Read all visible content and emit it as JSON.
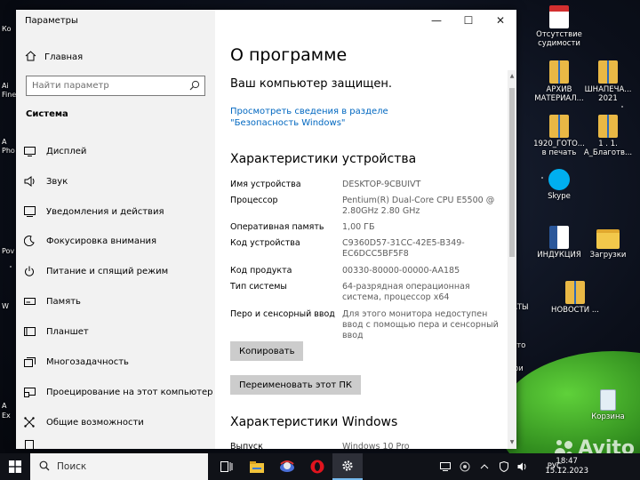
{
  "window": {
    "title": "Параметры",
    "controls": {
      "minimize": "—",
      "maximize": "☐",
      "close": "✕"
    }
  },
  "sidebar": {
    "home": "Главная",
    "search_placeholder": "Найти параметр",
    "section": "Система",
    "items": [
      {
        "label": "Дисплей",
        "icon": "display-icon"
      },
      {
        "label": "Звук",
        "icon": "sound-icon"
      },
      {
        "label": "Уведомления и действия",
        "icon": "notifications-icon"
      },
      {
        "label": "Фокусировка внимания",
        "icon": "focus-moon-icon"
      },
      {
        "label": "Питание и спящий режим",
        "icon": "power-icon"
      },
      {
        "label": "Память",
        "icon": "storage-icon"
      },
      {
        "label": "Планшет",
        "icon": "tablet-icon"
      },
      {
        "label": "Многозадачность",
        "icon": "multitasking-icon"
      },
      {
        "label": "Проецирование на этот компьютер",
        "icon": "projecting-icon"
      },
      {
        "label": "Общие возможности",
        "icon": "shared-experiences-icon"
      }
    ]
  },
  "content": {
    "title": "О программе",
    "protected": "Ваш компьютер защищен.",
    "security_link": "Просмотреть сведения в разделе \"Безопасность Windows\"",
    "device_heading": "Характеристики устройства",
    "specs": [
      {
        "key": "Имя устройства",
        "value": "DESKTOP-9CBUIVT"
      },
      {
        "key": "Процессор",
        "value": "Pentium(R) Dual-Core  CPU      E5500  @ 2.80GHz   2.80 GHz"
      },
      {
        "key": "Оперативная память",
        "value": "1,00 ГБ"
      },
      {
        "key": "Код устройства",
        "value": "C9360D57-31CC-42E5-B349-EC6DCC5BF5F8"
      },
      {
        "key": "Код продукта",
        "value": "00330-80000-00000-AA185"
      },
      {
        "key": "Тип системы",
        "value": "64-разрядная операционная система, процессор x64"
      },
      {
        "key": "Перо и сенсорный ввод",
        "value": "Для этого монитора недоступен ввод с помощью пера и сенсорный ввод"
      }
    ],
    "copy_button": "Копировать",
    "rename_button": "Переименовать этот ПК",
    "windows_heading": "Характеристики Windows",
    "partial_row": {
      "key": "Выпуск",
      "value": "Windows 10 Pro"
    }
  },
  "desktop_icons": [
    {
      "label": "Отсутствие судимости",
      "icon": "pdf-file-icon"
    },
    {
      "label": "АРХИВ МАТЕРИАЛ...",
      "icon": "archive-icon"
    },
    {
      "label": "ШНАПЕЧА... 2021",
      "icon": "archive-icon"
    },
    {
      "label": "1920_ГОТО... в печать",
      "icon": "archive-icon"
    },
    {
      "label": "1 . 1. А_Благотв...",
      "icon": "archive-icon"
    },
    {
      "label": "Skype",
      "icon": "skype-icon"
    },
    {
      "label": "ИНДУКЦИЯ",
      "icon": "word-document-icon"
    },
    {
      "label": "Загрузки",
      "icon": "downloads-folder-icon"
    },
    {
      "label": "НОВОСТИ ...",
      "icon": "archive-icon"
    },
    {
      "label": "Корзина",
      "icon": "recycle-bin-icon"
    }
  ],
  "left_edge_labels": [
    "Ко",
    "Ai",
    "Fine",
    "A",
    "Pho",
    "Pov",
    "W",
    "А",
    "Ex"
  ],
  "right_edge_labels": [
    "АТЫ",
    "ато",
    "фи"
  ],
  "taskbar": {
    "search": "Поиск",
    "language": "РУС",
    "time": "18:47",
    "date": "15.12.2023"
  },
  "watermark": "Avito"
}
